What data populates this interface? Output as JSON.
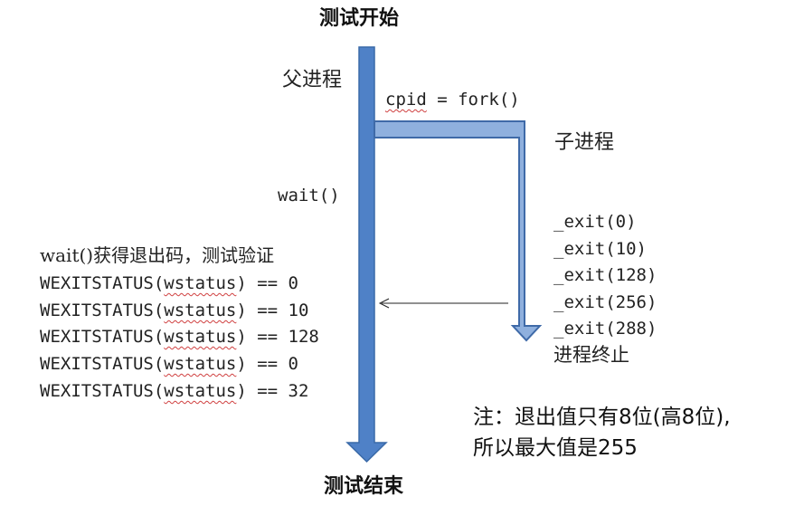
{
  "title_start": "测试开始",
  "title_end": "测试结束",
  "parent_label": "父进程",
  "child_label": "子进程",
  "fork_prefix": "cpid",
  "fork_suffix": " = fork()",
  "wait_label": "wait()",
  "left_heading": "wait()获得退出码，测试验证",
  "left_lines": [
    {
      "prefix": "WEXITSTATUS(",
      "var": "wstatus",
      "suffix": ") == 0"
    },
    {
      "prefix": "WEXITSTATUS(",
      "var": "wstatus",
      "suffix": ") == 10"
    },
    {
      "prefix": "WEXITSTATUS(",
      "var": "wstatus",
      "suffix": ") == 128"
    },
    {
      "prefix": "WEXITSTATUS(",
      "var": "wstatus",
      "suffix": ") == 0"
    },
    {
      "prefix": "WEXITSTATUS(",
      "var": "wstatus",
      "suffix": ") == 32"
    }
  ],
  "exit_calls": [
    "_exit(0)",
    "_exit(10)",
    "_exit(128)",
    "_exit(256)",
    "_exit(288)"
  ],
  "child_end": "进程终止",
  "note_line1": "注：退出值只有8位(高8位),",
  "note_line2": "所以最大值是255",
  "colors": {
    "arrow_fill": "#4f81c7",
    "arrow_stroke": "#3a6aa8",
    "fork_fill": "#8fb0de",
    "fork_stroke": "#3f6aa8"
  }
}
